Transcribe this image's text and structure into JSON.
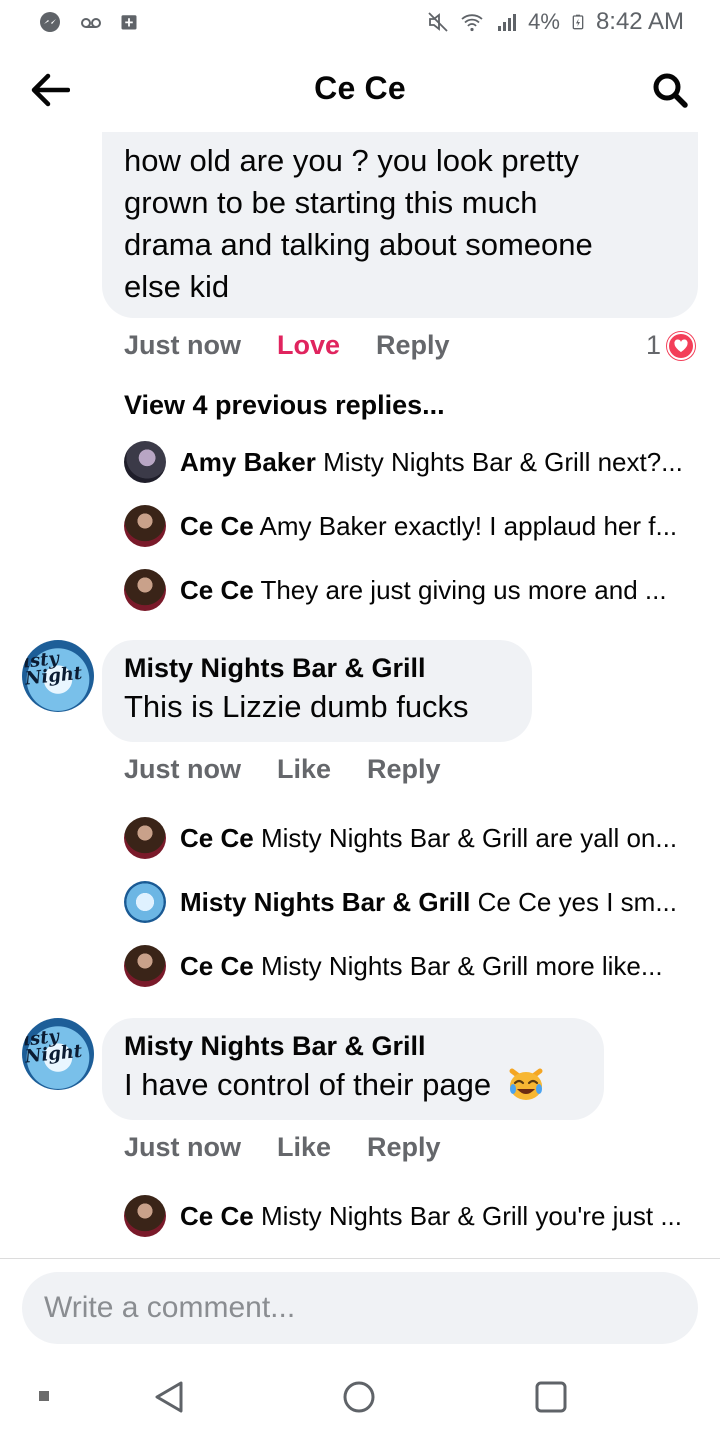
{
  "status_bar": {
    "battery_percent": "4%",
    "time": "8:42 AM"
  },
  "header": {
    "title": "Ce Ce"
  },
  "comments": [
    {
      "text_lines": [
        "how old are you ? you look pretty",
        "grown to be starting this much",
        "drama and talking about someone",
        "else kid"
      ],
      "time": "Just now",
      "reaction_action": "Love",
      "reply_label": "Reply",
      "reaction_count": "1",
      "view_previous": "View 4 previous replies...",
      "replies": [
        {
          "author": "Amy Baker",
          "text": "Misty Nights Bar & Grill next?..."
        },
        {
          "author": "Ce Ce",
          "text": "Amy Baker exactly! I applaud her f..."
        },
        {
          "author": "Ce Ce",
          "text": "They are just giving us more and ..."
        }
      ]
    },
    {
      "author": "Misty Nights Bar & Grill",
      "text": "This is Lizzie dumb fucks",
      "time": "Just now",
      "like_label": "Like",
      "reply_label": "Reply",
      "replies": [
        {
          "author": "Ce Ce",
          "text": "Misty Nights Bar & Grill are yall on..."
        },
        {
          "author": "Misty Nights Bar & Grill",
          "text": "Ce Ce yes I sm..."
        },
        {
          "author": "Ce Ce",
          "text": "Misty Nights Bar & Grill more like..."
        }
      ]
    },
    {
      "author": "Misty Nights Bar & Grill",
      "text": "I have control of their page",
      "time": "Just now",
      "like_label": "Like",
      "reply_label": "Reply",
      "replies": [
        {
          "author": "Ce Ce",
          "text": "Misty Nights Bar & Grill you're just ..."
        }
      ]
    }
  ],
  "page_avatar_logo": [
    "isty",
    "Night"
  ],
  "composer": {
    "placeholder": "Write a comment..."
  },
  "icons": {
    "back": "arrow-left-icon",
    "search": "search-icon",
    "love_reaction": "heart-icon",
    "emoji": "laughing-cat-emoji-icon"
  },
  "colors": {
    "love": "#e0245e",
    "heart": "#f33e58",
    "bubble": "#f0f2f5",
    "muted": "#65676b"
  }
}
